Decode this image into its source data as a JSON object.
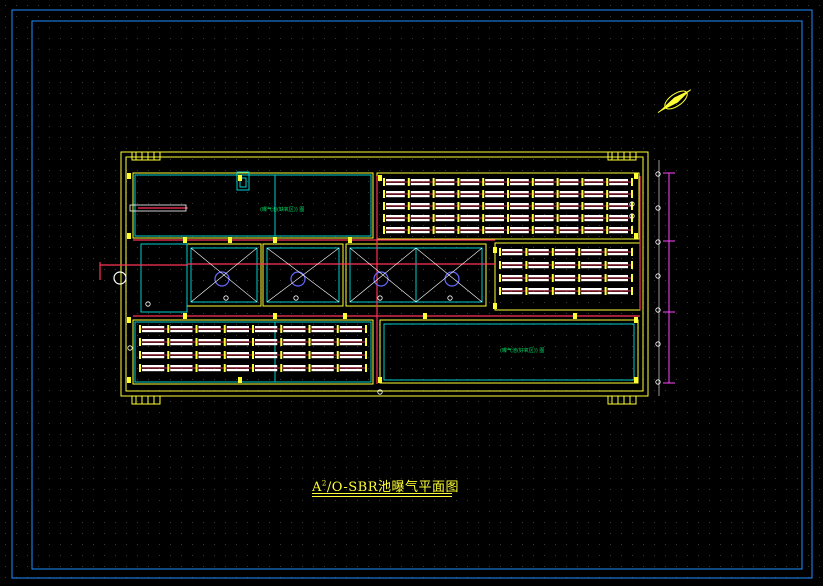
{
  "drawing": {
    "title_prefix": "A",
    "title_superscript": "2",
    "title_rest": "/O-SBR池曝气平面图"
  },
  "colors": {
    "background": "#000000",
    "frame": "#1e90ff",
    "outer_wall": "#ffff33",
    "inner_wall": "#00cccc",
    "pipe": "#ff3355",
    "diffuser": "#ffffff",
    "equipment": "#6666ff",
    "dimension": "#ff44ff",
    "label": "#00dd66"
  },
  "icons": {
    "north_arrow": "north-arrow-icon"
  }
}
